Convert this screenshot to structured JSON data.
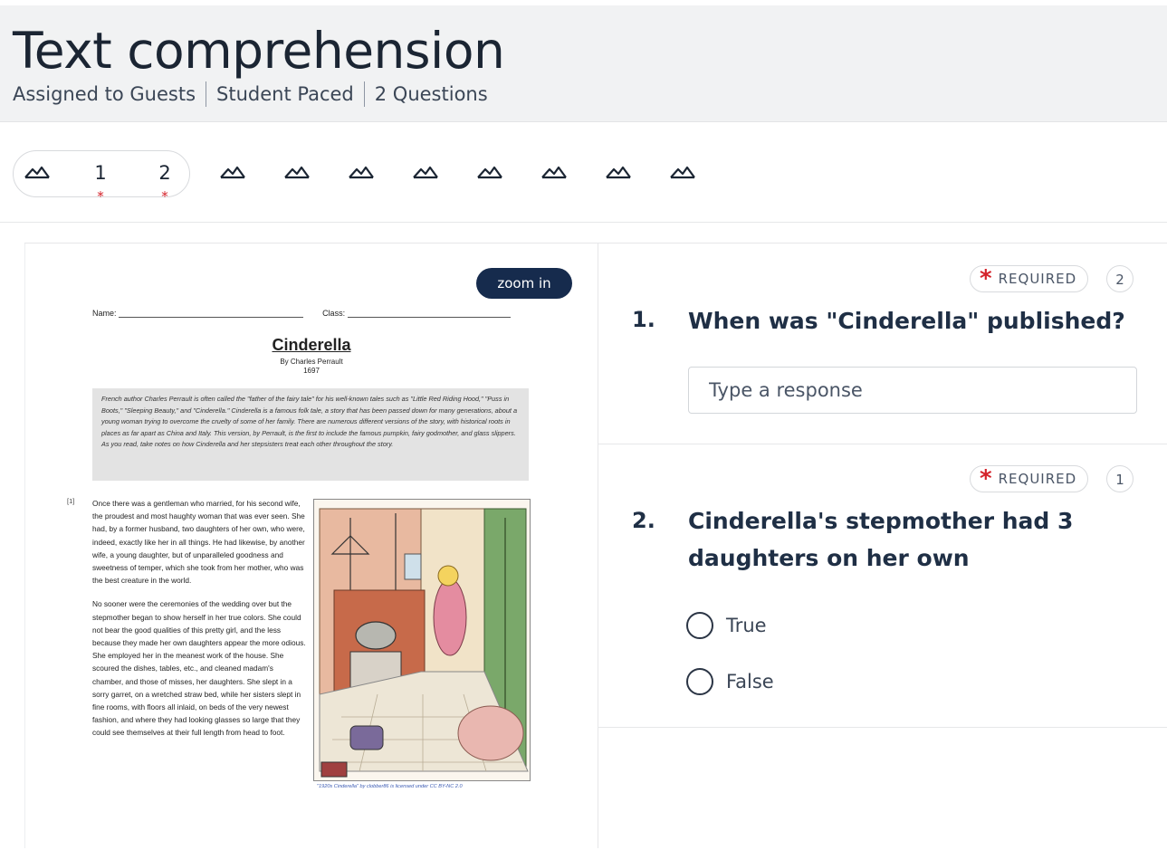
{
  "header": {
    "title": "Text comprehension",
    "meta": [
      "Assigned to Guests",
      "Student Paced",
      "2 Questions"
    ]
  },
  "nav": {
    "questions": [
      {
        "label": "1",
        "required_mark": "*"
      },
      {
        "label": "2",
        "required_mark": "*"
      }
    ],
    "icon": "mountain-image-icon",
    "image_slide_count": 8
  },
  "document": {
    "zoom_label": "zoom in",
    "name_label": "Name:",
    "class_label": "Class:",
    "title": "Cinderella",
    "author": "By Charles Perrault",
    "year": "1697",
    "intro": "French author Charles Perrault is often called the \"father of the fairy tale\" for his well-known tales such as \"Little Red Riding Hood,\" \"Puss in Boots,\" \"Sleeping Beauty,\" and \"Cinderella.\" Cinderella is a famous folk tale, a story that has been passed down for many generations, about a young woman trying to overcome the cruelty of some of her family. There are numerous different versions of the story, with historical roots in places as far apart as China and Italy. This version, by Perrault, is the first to include the famous pumpkin, fairy godmother, and glass slippers. As you read, take notes on how Cinderella and her stepsisters treat each other throughout the story.",
    "para_number": "[1]",
    "paragraph1": "Once there was a gentleman who married, for his second wife, the proudest and most haughty woman that was ever seen. She had, by a former husband, two daughters of her own, who were, indeed, exactly like her in all things. He had likewise, by another wife, a young daughter, but of unparalleled goodness and sweetness of temper, which she took from her mother, who was the best creature in the world.",
    "paragraph2": "No sooner were the ceremonies of the wedding over but the stepmother began to show herself in her true colors. She could not bear the good qualities of this pretty girl, and the less because they made her own daughters appear the more odious. She employed her in the meanest work of the house. She scoured the dishes, tables, etc., and cleaned madam's chamber, and those of misses, her daughters. She slept in a sorry garret, on a wretched straw bed, while her sisters slept in fine rooms, with floors all inlaid, on beds of the very newest fashion, and where they had looking glasses so large that they could see themselves at their full length from head to foot.",
    "credit": "\"1920s Cinderella\" by clobber86 is licensed under CC BY-NC 2.0"
  },
  "questions": [
    {
      "number": "1.",
      "required_label": "REQUIRED",
      "points": "2",
      "text": "When was \"Cinderella\" published?",
      "placeholder": "Type a response"
    },
    {
      "number": "2.",
      "required_label": "REQUIRED",
      "points": "1",
      "text_line1": "Cinderella's stepmother had 3",
      "text_line2": "daughters on her own",
      "options": [
        "True",
        "False"
      ]
    }
  ],
  "colors": {
    "header_bg": "#f1f2f3",
    "required_red": "#d4232b",
    "zoom_button": "#162b4d",
    "text_dark": "#1f2f45"
  }
}
